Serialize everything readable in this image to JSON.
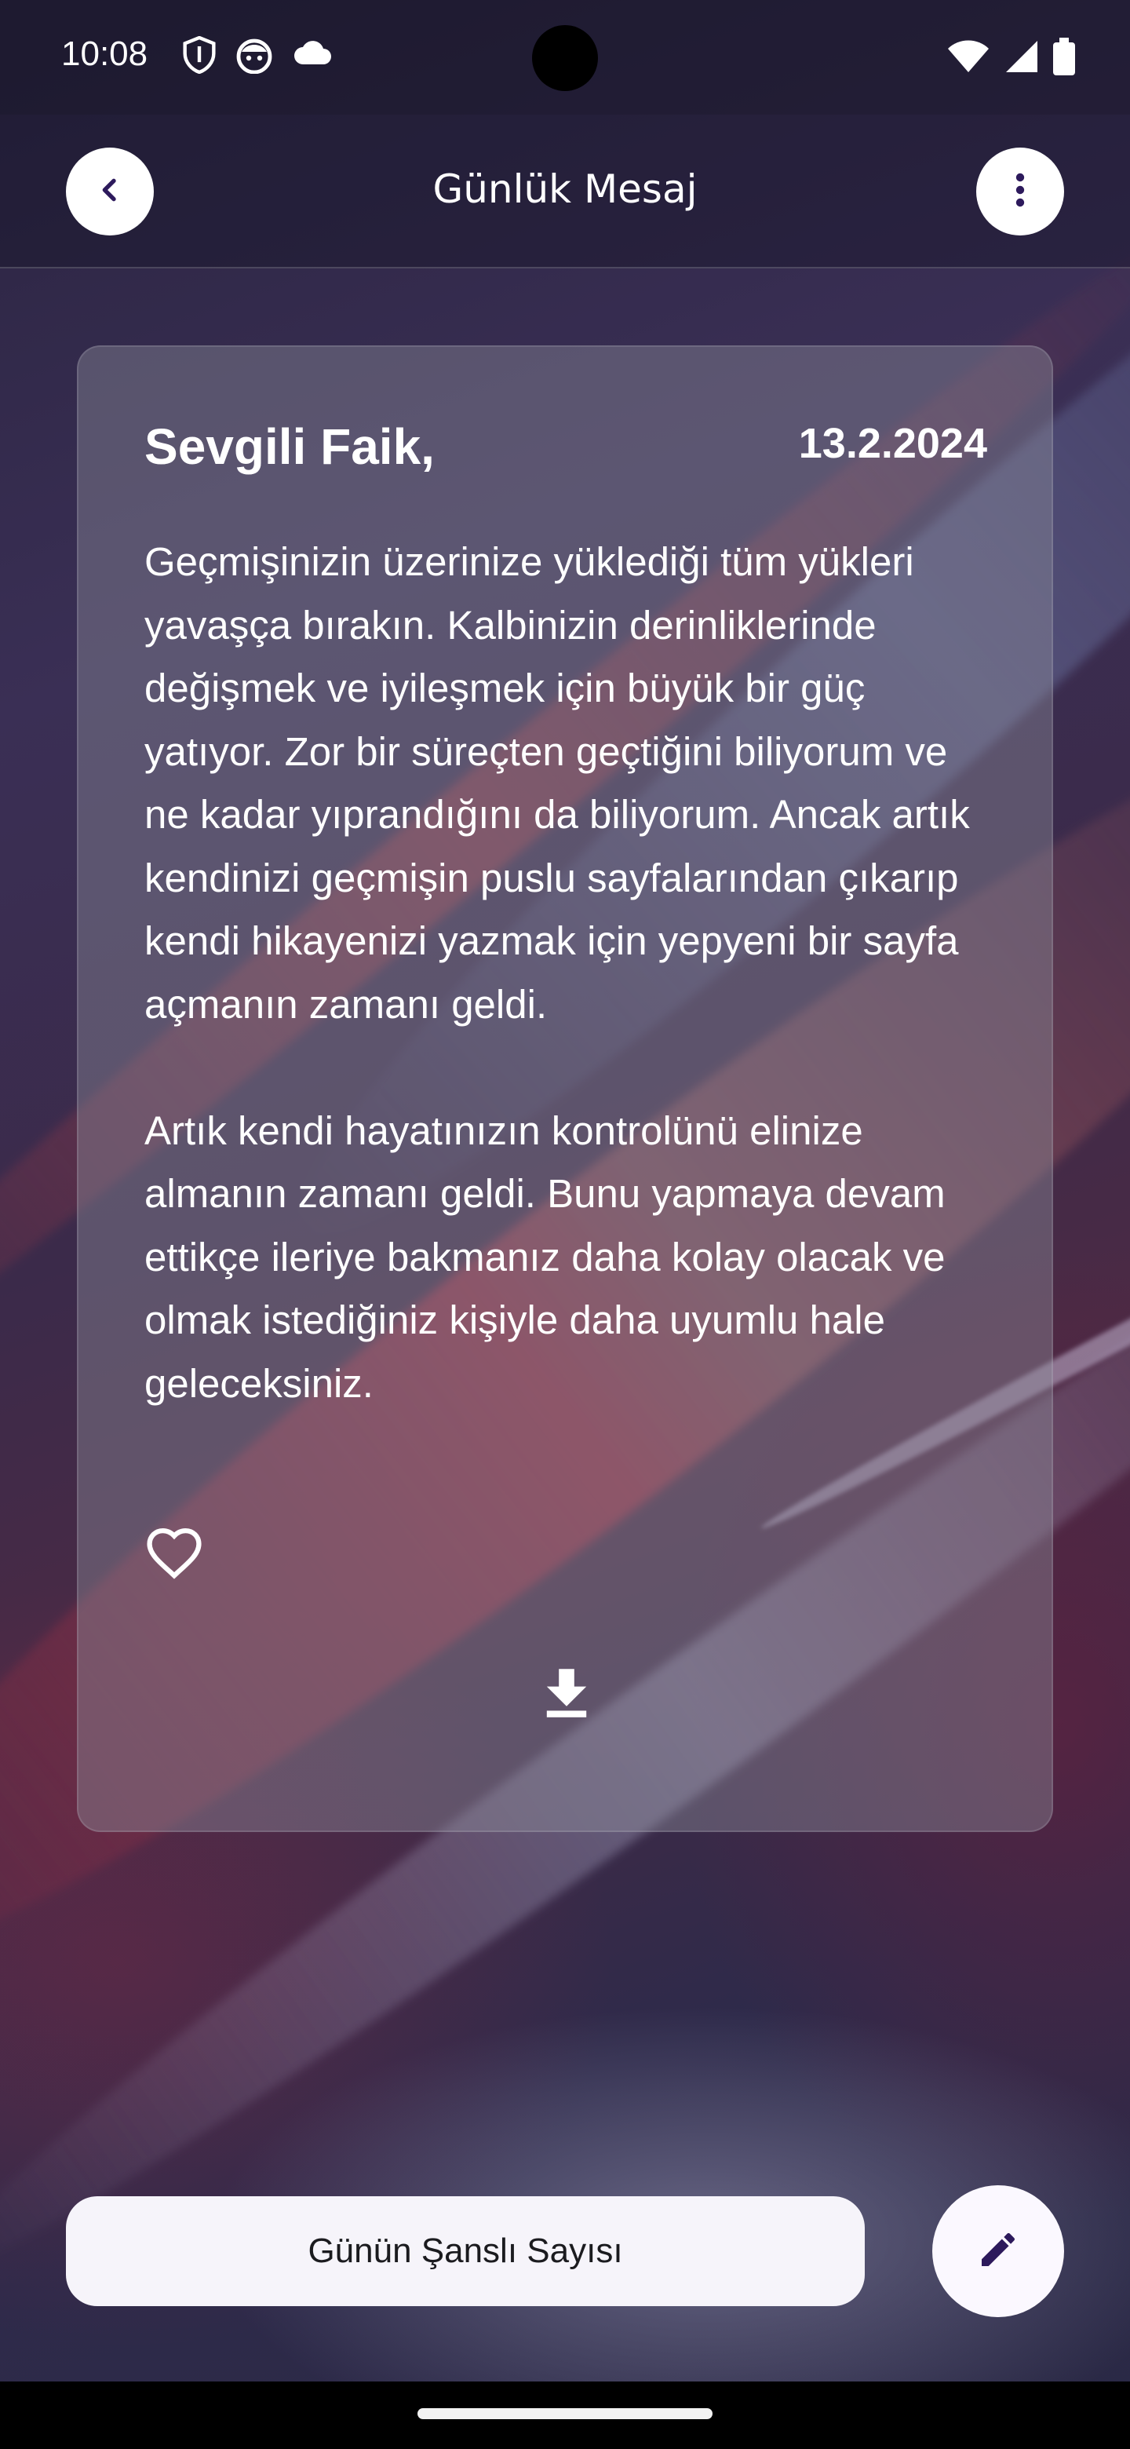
{
  "status_bar": {
    "time": "10:08",
    "left_icons": [
      "shield-icon",
      "face-icon",
      "cloud-icon"
    ],
    "right_icons": [
      "wifi-icon",
      "signal-icon",
      "battery-icon"
    ]
  },
  "app_bar": {
    "title": "Günlük Mesaj",
    "back_icon": "chevron-left-icon",
    "menu_icon": "more-vert-icon"
  },
  "card": {
    "salutation": "Sevgili Faik,",
    "date": "13.2.2024",
    "paragraphs": [
      "Geçmişinizin üzerinize yüklediği tüm yükleri yavaşça bırakın. Kalbinizin derinliklerinde değişmek ve iyileşmek için büyük bir güç yatıyor. Zor bir süreçten geçtiğini biliyorum ve ne kadar yıprandığını da biliyorum. Ancak artık kendinizi geçmişin puslu sayfalarından çıkarıp kendi hikayenizi yazmak için yepyeni bir sayfa açmanın zamanı geldi.",
      "Artık kendi hayatınızın kontrolünü elinize almanın zamanı geldi. Bunu yapmaya devam ettikçe ileriye bakmanız daha kolay olacak ve olmak istediğiniz kişiyle daha uyumlu hale geleceksiniz."
    ],
    "favorite_icon": "heart-outline-icon",
    "download_icon": "download-icon"
  },
  "actions": {
    "lucky_number_label": "Günün Şanslı Sayısı",
    "edit_icon": "pencil-icon",
    "accent_color": "#2d1a5c"
  }
}
